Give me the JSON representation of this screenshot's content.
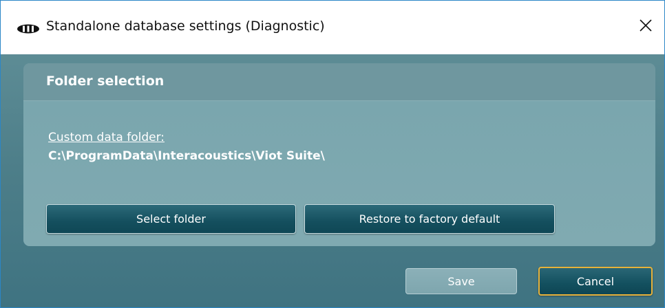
{
  "window": {
    "title": "Standalone database settings (Diagnostic)",
    "app_icon": "interacoustics-logo-icon",
    "close_icon": "close-icon"
  },
  "folder_selection": {
    "heading": "Folder selection",
    "custom_folder_label": "Custom data folder:",
    "path": "C:\\ProgramData\\Interacoustics\\Viot Suite\\",
    "select_folder_label": "Select folder",
    "restore_default_label": "Restore to factory default"
  },
  "footer": {
    "save_label": "Save",
    "cancel_label": "Cancel"
  },
  "colors": {
    "accent_border": "#2b86c7",
    "panel_bg": "#4d7e89",
    "button_bg": "#144f5e",
    "focus_outline": "#e8b23a"
  }
}
